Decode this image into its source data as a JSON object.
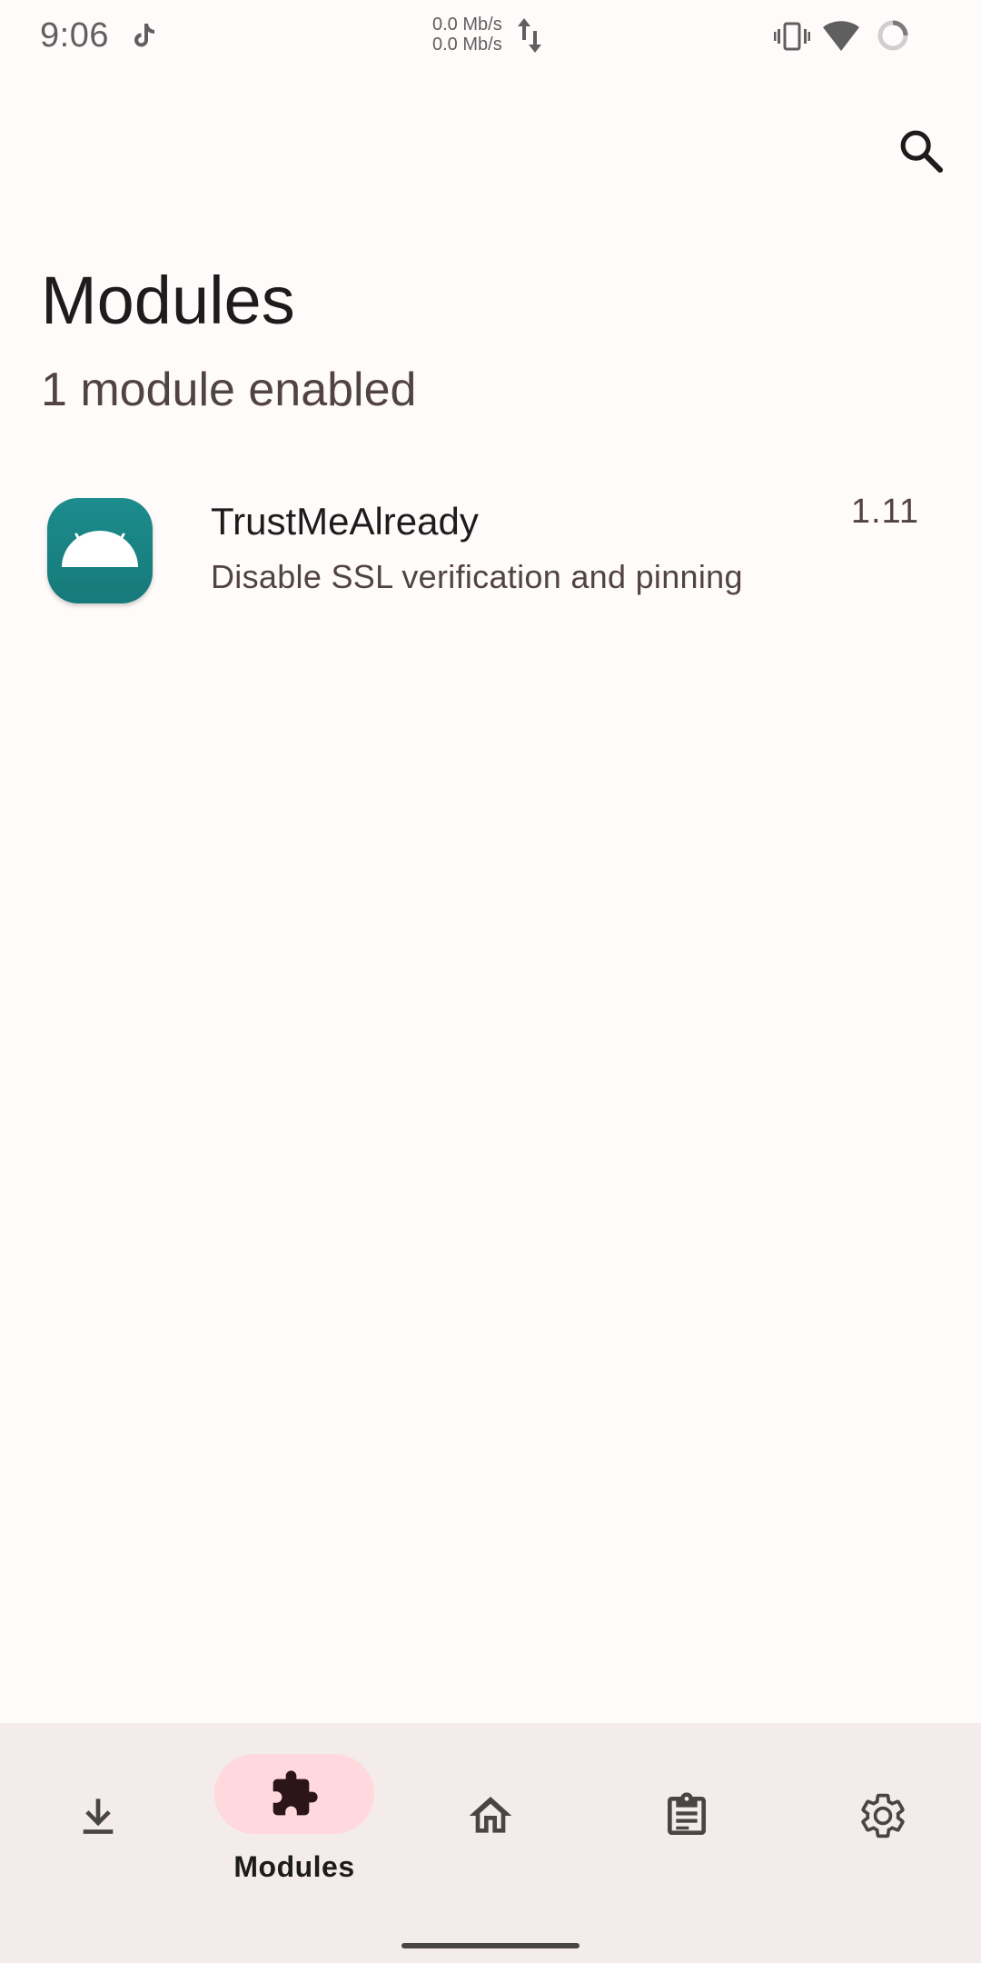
{
  "status_bar": {
    "time": "9:06",
    "net_up": "0.0 Mb/s",
    "net_down": "0.0 Mb/s",
    "icons": [
      "tiktok-icon",
      "data-arrows-icon",
      "vibrate-icon",
      "wifi-icon",
      "battery-icon"
    ]
  },
  "toolbar": {
    "search_icon": "search-icon"
  },
  "header": {
    "title": "Modules",
    "subtitle": "1 module enabled"
  },
  "modules": [
    {
      "name": "TrustMeAlready",
      "description": "Disable SSL verification and pinning",
      "version": "1.11",
      "icon": "android-icon",
      "icon_color": "#1c8c8c"
    }
  ],
  "bottom_nav": {
    "items": [
      {
        "id": "repository",
        "icon": "download-icon",
        "label": ""
      },
      {
        "id": "modules",
        "icon": "puzzle-icon",
        "label": "Modules",
        "selected": true
      },
      {
        "id": "home",
        "icon": "home-icon",
        "label": ""
      },
      {
        "id": "logs",
        "icon": "clipboard-icon",
        "label": ""
      },
      {
        "id": "settings",
        "icon": "gear-icon",
        "label": ""
      }
    ],
    "selected_pill_color": "#ffd9de",
    "background_color": "#f4eceb"
  }
}
